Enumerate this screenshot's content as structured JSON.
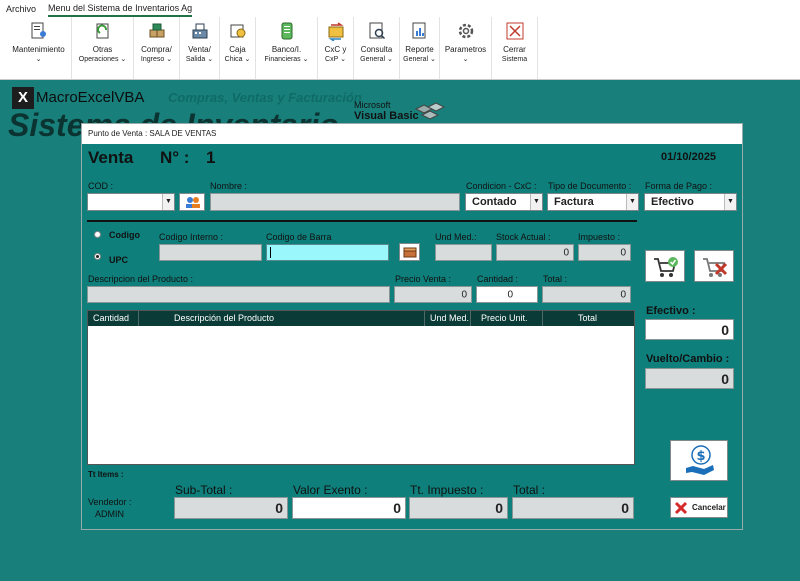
{
  "menubar": {
    "tabs": [
      "Archivo",
      "Menu del Sistema de Inventarios Ag"
    ]
  },
  "ribbon": {
    "buttons": [
      {
        "l1": "Mantenimiento",
        "l2": "⌄"
      },
      {
        "l1": "Otras",
        "l2": "Operaciones ⌄"
      },
      {
        "l1": "Compra/",
        "l2": "Ingreso ⌄"
      },
      {
        "l1": "Venta/",
        "l2": "Salida ⌄"
      },
      {
        "l1": "Caja",
        "l2": "Chica ⌄"
      },
      {
        "l1": "Banco/I.",
        "l2": "Financieras ⌄"
      },
      {
        "l1": "CxC y",
        "l2": "CxP ⌄"
      },
      {
        "l1": "Consulta",
        "l2": "General ⌄"
      },
      {
        "l1": "Reporte",
        "l2": "General ⌄"
      },
      {
        "l1": "Parametros",
        "l2": "⌄"
      },
      {
        "l1": "Cerrar",
        "l2": "Sistema"
      }
    ]
  },
  "banner": {
    "brand": "MacroExcelVBA",
    "tagline": "Compras, Ventas y Facturación",
    "title": "Sistema de Inventario",
    "vb_small": "Microsoft",
    "vb_big": "Visual Basic"
  },
  "dialog": {
    "window_title": "Punto de Venta : SALA DE VENTAS",
    "heading": "Venta",
    "number_label": "N° :",
    "number": "1",
    "date": "01/10/2025",
    "labels": {
      "cod": "COD :",
      "nombre": "Nombre :",
      "condicion": "Condicion - CxC :",
      "tipo_doc": "Tipo de Documento :",
      "forma_pago": "Forma de Pago :",
      "codigo_radio": "Codigo",
      "upc_radio": "UPC",
      "codigo_interno": "Codigo Interno :",
      "codigo_barra": "Codigo de Barra",
      "und_med": "Und Med.:",
      "stock_actual": "Stock Actual :",
      "impuesto": "Impuesto :",
      "descripcion": "Descripcion del Producto :",
      "precio_venta": "Precio Venta :",
      "cantidad": "Cantidad :",
      "total": "Total :",
      "efectivo": "Efectivo :",
      "vuelto": "Vuelto/Cambio :",
      "tt_items": "Tt Items :",
      "vendedor": "Vendedor :",
      "subtotal": "Sub-Total :",
      "valor_exento": "Valor Exento :",
      "tt_impuesto": "Tt. Impuesto :",
      "total_bottom": "Total :"
    },
    "values": {
      "condicion": "Contado",
      "tipo_doc": "Factura",
      "forma_pago": "Efectivo",
      "stock_actual": "0",
      "impuesto": "0",
      "precio_venta": "0",
      "cantidad": "0",
      "total": "0",
      "efectivo": "0",
      "vuelto": "0",
      "vendedor": "ADMIN",
      "subtotal": "0",
      "valor_exento": "0",
      "tt_impuesto": "0",
      "total_bottom": "0"
    },
    "grid_columns": [
      "Cantidad",
      "Descripción del Producto",
      "Und Med.",
      "Precio Unit.",
      "Total"
    ],
    "cancel_label": "Cancelar"
  },
  "colors": {
    "background": "#187F7B",
    "dialog": "#0E7F7B",
    "grid_header": "#0b3b36",
    "barcode_field": "#9af7fb"
  }
}
